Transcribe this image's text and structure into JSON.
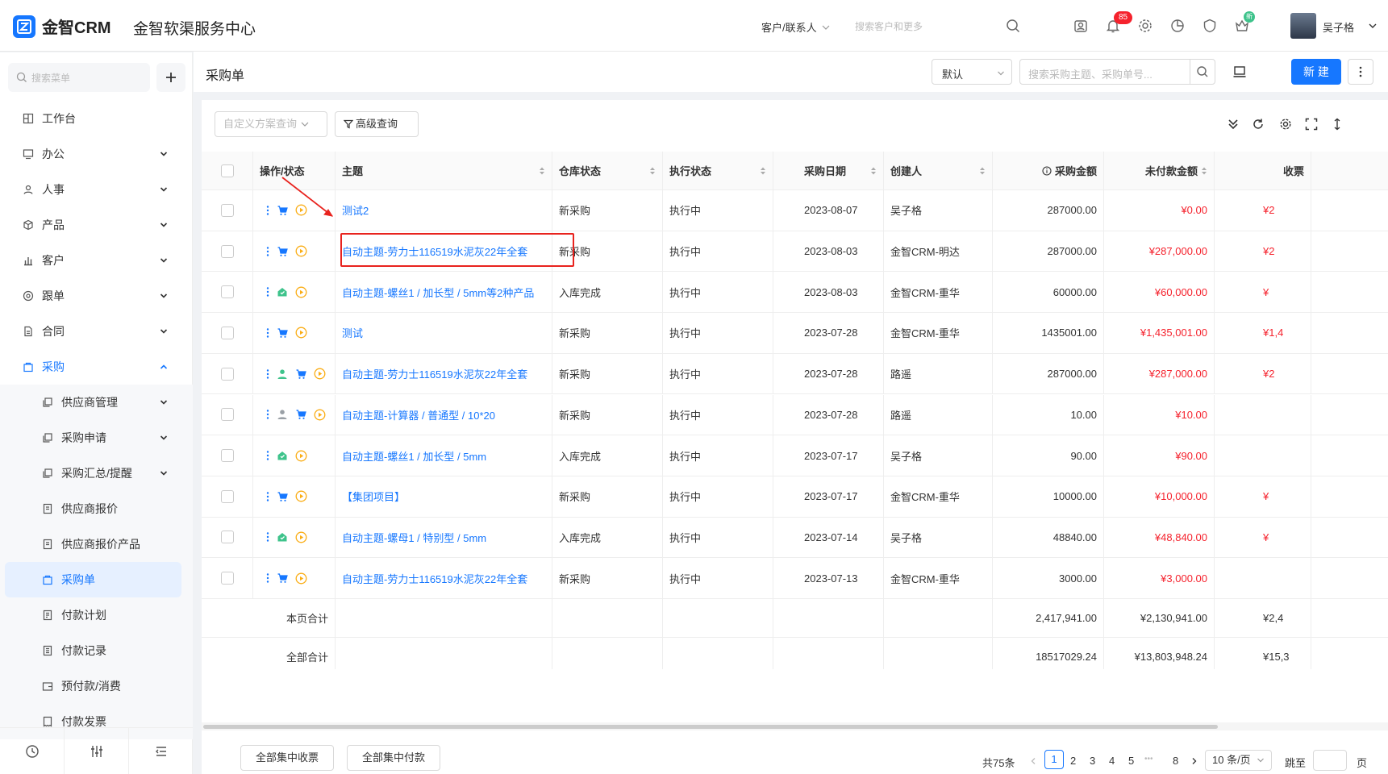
{
  "app": {
    "brand": "金智CRM",
    "title": "金智软渠服务中心"
  },
  "topbar": {
    "search_scope": "客户/联系人",
    "search_placeholder": "搜索客户和更多",
    "notification_count": "85",
    "badge_text": "新",
    "user_name": "吴子格",
    "icons": [
      "search-icon",
      "contact-icon",
      "bell-icon",
      "gear-icon",
      "chart-icon",
      "shield-icon",
      "crown-icon"
    ]
  },
  "sidebar": {
    "search_placeholder": "搜索菜单",
    "items": [
      {
        "label": "工作台",
        "icon": "grid-icon"
      },
      {
        "label": "办公",
        "icon": "monitor-icon"
      },
      {
        "label": "人事",
        "icon": "users-icon"
      },
      {
        "label": "产品",
        "icon": "cube-icon"
      },
      {
        "label": "客户",
        "icon": "bar-chart-icon"
      },
      {
        "label": "跟单",
        "icon": "target-icon"
      },
      {
        "label": "合同",
        "icon": "document-icon"
      },
      {
        "label": "采购",
        "icon": "bag-icon"
      }
    ],
    "sub_items": [
      {
        "label": "供应商管理"
      },
      {
        "label": "采购申请"
      },
      {
        "label": "采购汇总/提醒"
      },
      {
        "label": "供应商报价"
      },
      {
        "label": "供应商报价产品"
      },
      {
        "label": "采购单"
      },
      {
        "label": "付款计划"
      },
      {
        "label": "付款记录"
      },
      {
        "label": "预付款/消费"
      },
      {
        "label": "付款发票"
      }
    ]
  },
  "page": {
    "title": "采购单",
    "view_select": "默认",
    "search_placeholder": "搜索采购主题、采购单号...",
    "new_button": "新 建"
  },
  "toolbar": {
    "custom_query": "自定义方案查询",
    "advanced_query": "高级查询"
  },
  "table": {
    "headers": [
      "操作/状态",
      "主题",
      "仓库状态",
      "执行状态",
      "采购日期",
      "创建人",
      "采购金额",
      "未付款金额",
      "收票"
    ],
    "rows": [
      {
        "subject": "测试2",
        "warehouse": "新采购",
        "exec": "执行中",
        "date": "2023-08-07",
        "creator": "吴子格",
        "amount": "287000.00",
        "unpaid": "¥0.00",
        "inv": "¥2",
        "icons": [
          "cart"
        ]
      },
      {
        "subject": "自动主题-劳力士116519水泥灰22年全套",
        "warehouse": "新采购",
        "exec": "执行中",
        "date": "2023-08-03",
        "creator": "金智CRM-明达",
        "amount": "287000.00",
        "unpaid": "¥287,000.00",
        "inv": "¥2",
        "icons": [
          "cart"
        ]
      },
      {
        "subject": "自动主题-螺丝1 / 加长型 / 5mm等2种产品",
        "warehouse": "入库完成",
        "exec": "执行中",
        "date": "2023-08-03",
        "creator": "金智CRM-重华",
        "amount": "60000.00",
        "unpaid": "¥60,000.00",
        "inv": "¥",
        "icons": [
          "house"
        ]
      },
      {
        "subject": "测试",
        "warehouse": "新采购",
        "exec": "执行中",
        "date": "2023-07-28",
        "creator": "金智CRM-重华",
        "amount": "1435001.00",
        "unpaid": "¥1,435,001.00",
        "inv": "¥1,4",
        "icons": [
          "cart"
        ]
      },
      {
        "subject": "自动主题-劳力士116519水泥灰22年全套",
        "warehouse": "新采购",
        "exec": "执行中",
        "date": "2023-07-28",
        "creator": "路遥",
        "amount": "287000.00",
        "unpaid": "¥287,000.00",
        "inv": "¥2",
        "icons": [
          "user-green",
          "cart"
        ]
      },
      {
        "subject": "自动主题-计算器 / 普通型 / 10*20",
        "warehouse": "新采购",
        "exec": "执行中",
        "date": "2023-07-28",
        "creator": "路遥",
        "amount": "10.00",
        "unpaid": "¥10.00",
        "inv": "",
        "icons": [
          "user-gray",
          "cart"
        ]
      },
      {
        "subject": "自动主题-螺丝1 / 加长型 / 5mm",
        "warehouse": "入库完成",
        "exec": "执行中",
        "date": "2023-07-17",
        "creator": "吴子格",
        "amount": "90.00",
        "unpaid": "¥90.00",
        "inv": "",
        "icons": [
          "house"
        ]
      },
      {
        "subject": "【集团项目】",
        "warehouse": "新采购",
        "exec": "执行中",
        "date": "2023-07-17",
        "creator": "金智CRM-重华",
        "amount": "10000.00",
        "unpaid": "¥10,000.00",
        "inv": "¥",
        "icons": [
          "cart"
        ]
      },
      {
        "subject": "自动主题-螺母1 / 特别型 / 5mm",
        "warehouse": "入库完成",
        "exec": "执行中",
        "date": "2023-07-14",
        "creator": "吴子格",
        "amount": "48840.00",
        "unpaid": "¥48,840.00",
        "inv": "¥",
        "icons": [
          "house"
        ]
      },
      {
        "subject": "自动主题-劳力士116519水泥灰22年全套",
        "warehouse": "新采购",
        "exec": "执行中",
        "date": "2023-07-13",
        "creator": "金智CRM-重华",
        "amount": "3000.00",
        "unpaid": "¥3,000.00",
        "inv": "",
        "icons": [
          "cart"
        ]
      }
    ],
    "page_total": {
      "label": "本页合计",
      "amount": "2,417,941.00",
      "unpaid": "¥2,130,941.00",
      "inv": "¥2,4"
    },
    "grand_total": {
      "label": "全部合计",
      "amount": "18517029.24",
      "unpaid": "¥13,803,948.24",
      "inv": "¥15,3"
    }
  },
  "footer": {
    "btn_invoice": "全部集中收票",
    "btn_pay": "全部集中付款",
    "total": "共75条",
    "pages": [
      "1",
      "2",
      "3",
      "4",
      "5",
      "8"
    ],
    "ellipsis": "•••",
    "page_size": "10 条/页",
    "jump": "跳至",
    "page_unit": "页"
  },
  "colors": {
    "accent": "#1677ff",
    "danger": "#f5222d",
    "success": "#3ec38b",
    "annotation": "#e8231e"
  }
}
